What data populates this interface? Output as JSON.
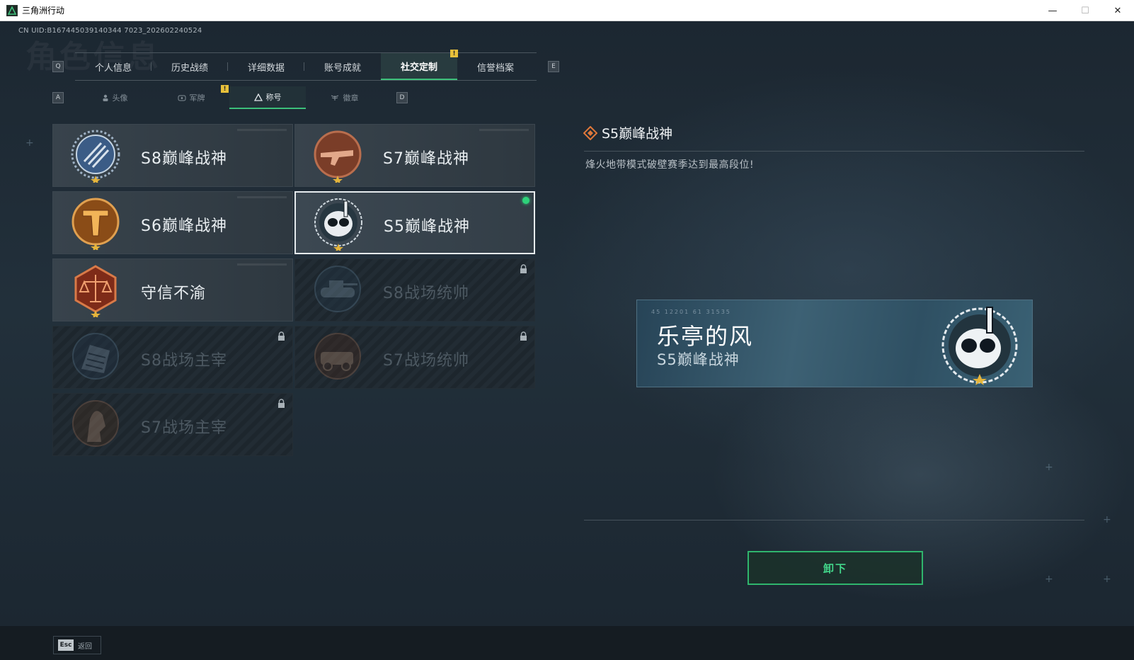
{
  "window": {
    "title": "三角洲行动",
    "minimize": "—",
    "maximize": "☐",
    "close": "✕"
  },
  "uid_text": "CN UID:B167445039140344 7023_202602240524",
  "ghost_title": "角色信息",
  "keys": {
    "prev_tab": "Q",
    "next_tab": "E",
    "prev_sub": "A",
    "next_sub": "D"
  },
  "tabs": [
    {
      "label": "个人信息"
    },
    {
      "label": "历史战绩"
    },
    {
      "label": "详细数据"
    },
    {
      "label": "账号成就"
    },
    {
      "label": "社交定制",
      "active": true,
      "alert": "!"
    },
    {
      "label": "信誉档案"
    }
  ],
  "subtabs": [
    {
      "label": "头像",
      "icon": "person-icon"
    },
    {
      "label": "军牌",
      "icon": "dogtag-icon",
      "alert": "!"
    },
    {
      "label": "称号",
      "icon": "triangle-icon",
      "active": true
    },
    {
      "label": "徽章",
      "icon": "wings-icon"
    }
  ],
  "titles": [
    {
      "name": "S8巅峰战神",
      "badge": "blue-stripes-badge",
      "color": "#5a79a6",
      "locked": false
    },
    {
      "name": "S7巅峰战神",
      "badge": "copper-rifle-badge",
      "color": "#a65a3c",
      "locked": false
    },
    {
      "name": "S6巅峰战神",
      "badge": "gold-t-badge",
      "color": "#c87a22",
      "locked": false
    },
    {
      "name": "S5巅峰战神",
      "badge": "skull-diver-badge",
      "color": "#3d5a66",
      "locked": false,
      "selected": true,
      "equipped": true
    },
    {
      "name": "守信不渝",
      "badge": "scales-badge",
      "color": "#b5542c",
      "locked": false
    },
    {
      "name": "S8战场统帅",
      "badge": "tank-badge",
      "color": "#3e5a70",
      "locked": true
    },
    {
      "name": "S8战场主宰",
      "badge": "building-badge",
      "color": "#3a5470",
      "locked": true
    },
    {
      "name": "S7战场统帅",
      "badge": "vehicle-badge",
      "color": "#6c4a34",
      "locked": true
    },
    {
      "name": "S7战场主宰",
      "badge": "warrior-badge",
      "color": "#6a4a30",
      "locked": true
    }
  ],
  "detail": {
    "title": "S5巅峰战神",
    "description": "烽火地带模式破壁赛季达到最高段位!"
  },
  "name_card": {
    "player": "乐亭的风",
    "title": "S5巅峰战神",
    "code": "45 12201  61 31535"
  },
  "unequip_label": "卸下",
  "back": {
    "key": "Esc",
    "label": "返回"
  }
}
